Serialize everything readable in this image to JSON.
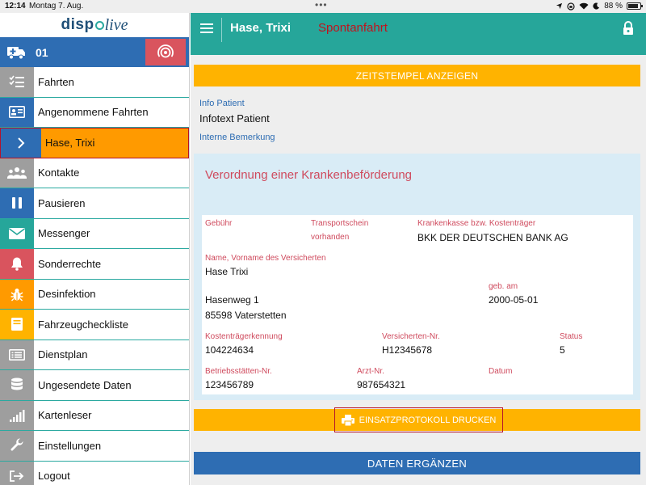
{
  "status_bar": {
    "time": "12:14",
    "date": "Montag 7. Aug.",
    "battery": "88 %",
    "battery_level": 0.88
  },
  "logo": {
    "part1": "disp",
    "part2": "live"
  },
  "vehicle": {
    "number": "01"
  },
  "sidebar": {
    "items": [
      {
        "label": "Fahrten",
        "icon": "checklist-icon",
        "color": "#9e9e9e"
      },
      {
        "label": "Angenommene Fahrten",
        "icon": "id-card-icon",
        "color": "#2e6db3"
      },
      {
        "label": "Hase, Trixi",
        "icon": "chevron-right-icon",
        "color": "#2e6db3",
        "active": true
      },
      {
        "label": "Kontakte",
        "icon": "users-icon",
        "color": "#9e9e9e"
      },
      {
        "label": "Pausieren",
        "icon": "pause-icon",
        "color": "#2e6db3"
      },
      {
        "label": "Messenger",
        "icon": "envelope-icon",
        "color": "#26a69a"
      },
      {
        "label": "Sonderrechte",
        "icon": "bell-icon",
        "color": "#d9545e"
      },
      {
        "label": "Desinfektion",
        "icon": "bug-icon",
        "color": "#ff9a00"
      },
      {
        "label": "Fahrzeugcheckliste",
        "icon": "book-icon",
        "color": "#ffb300"
      },
      {
        "label": "Dienstplan",
        "icon": "list-icon",
        "color": "#9e9e9e"
      },
      {
        "label": "Ungesendete Daten",
        "icon": "database-icon",
        "color": "#9e9e9e"
      },
      {
        "label": "Kartenleser",
        "icon": "signal-bars-icon",
        "color": "#9e9e9e"
      },
      {
        "label": "Einstellungen",
        "icon": "wrench-icon",
        "color": "#9e9e9e"
      },
      {
        "label": "Logout",
        "icon": "logout-icon",
        "color": "#9e9e9e"
      }
    ]
  },
  "header": {
    "title": "Hase, Trixi",
    "mode": "Spontanfahrt"
  },
  "main": {
    "timestamp_button": "ZEITSTEMPEL ANZEIGEN",
    "info_patient_label": "Info Patient",
    "info_patient_value": "Infotext Patient",
    "remark_label": "Interne Bemerkung",
    "card_heading": "Verordnung einer Krankenbeförderung",
    "fields": {
      "fee_label": "Gebühr",
      "transport_label": "Transportschein vorhanden",
      "insurer_label": "Krankenkasse bzw. Kostenträger",
      "insurer_value": "BKK DER DEUTSCHEN BANK AG",
      "name_label": "Name, Vorname des Versicherten",
      "name_value": "Hase Trixi",
      "street_value": "Hasenweg 1",
      "city_value": "85598 Vaterstetten",
      "birth_label": "geb. am",
      "birth_value": "2000-05-01",
      "payer_id_label": "Kostenträgerkennung",
      "payer_id_value": "104224634",
      "insured_no_label": "Versicherten-Nr.",
      "insured_no_value": "H12345678",
      "status_label": "Status",
      "status_value": "5",
      "site_no_label": "Betriebsstätten-Nr.",
      "site_no_value": "123456789",
      "doctor_no_label": "Arzt-Nr.",
      "doctor_no_value": "987654321",
      "date_label": "Datum"
    },
    "print_button": "EINSATZPROTOKOLL DRUCKEN",
    "complete_button": "DATEN ERGÄNZEN"
  },
  "colors": {
    "teal": "#26a69a",
    "blue": "#2e6db3",
    "orange": "#ff9a00",
    "yellow": "#ffb300",
    "red": "#cf4a5d"
  }
}
